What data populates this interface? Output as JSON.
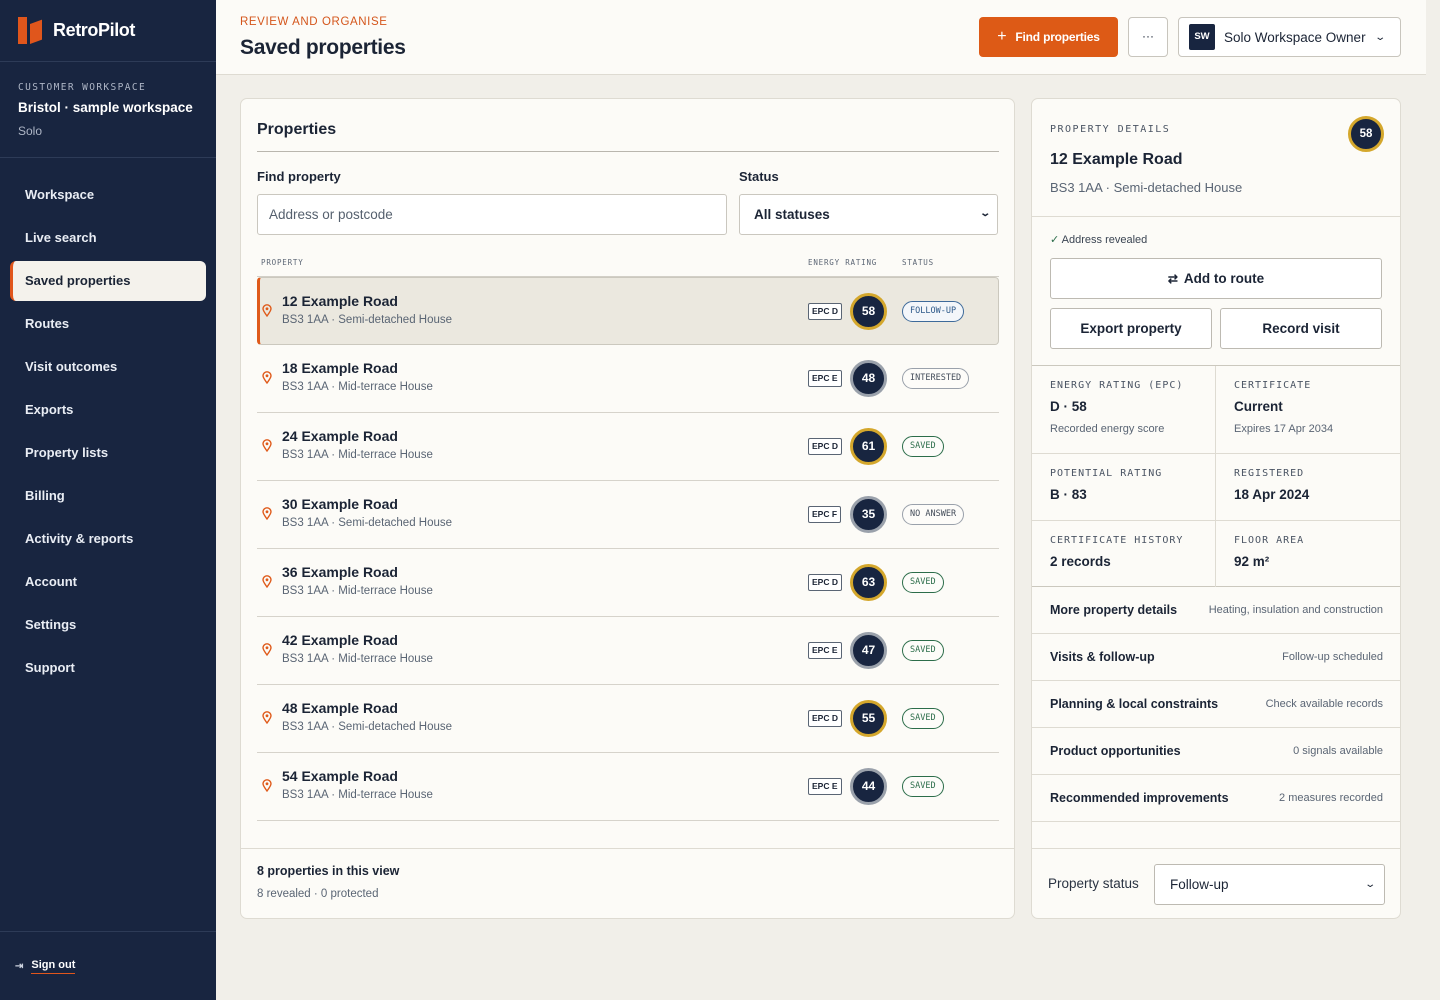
{
  "app": {
    "name": "RetroPilot"
  },
  "workspace": {
    "label": "CUSTOMER WORKSPACE",
    "name": "Bristol · sample workspace",
    "plan": "Solo"
  },
  "nav": [
    {
      "label": "Workspace",
      "active": false
    },
    {
      "label": "Live search",
      "active": false
    },
    {
      "label": "Saved properties",
      "active": true
    },
    {
      "label": "Routes",
      "active": false
    },
    {
      "label": "Visit outcomes",
      "active": false
    },
    {
      "label": "Exports",
      "active": false
    },
    {
      "label": "Property lists",
      "active": false
    },
    {
      "label": "Billing",
      "active": false
    },
    {
      "label": "Activity & reports",
      "active": false
    },
    {
      "label": "Account",
      "active": false
    },
    {
      "label": "Settings",
      "active": false
    },
    {
      "label": "Support",
      "active": false
    }
  ],
  "signout": {
    "label": "Sign out"
  },
  "header": {
    "eyebrow": "REVIEW AND ORGANISE",
    "title": "Saved properties",
    "find_button": "Find properties",
    "more_button": "···",
    "user": {
      "initials": "SW",
      "name": "Solo Workspace Owner"
    }
  },
  "properties": {
    "heading": "Properties",
    "find_label": "Find property",
    "find_placeholder": "Address or postcode",
    "status_label": "Status",
    "status_value": "All statuses",
    "columns": {
      "property": "PROPERTY",
      "energy": "ENERGY RATING",
      "status": "STATUS"
    },
    "rows": [
      {
        "title": "12 Example Road",
        "sub": "BS3 1AA · Semi-detached House",
        "epc": "EPC D",
        "score": "58",
        "status": "FOLLOW-UP"
      },
      {
        "title": "18 Example Road",
        "sub": "BS3 1AA · Mid-terrace House",
        "epc": "EPC E",
        "score": "48",
        "status": "INTERESTED"
      },
      {
        "title": "24 Example Road",
        "sub": "BS3 1AA · Mid-terrace House",
        "epc": "EPC D",
        "score": "61",
        "status": "SAVED"
      },
      {
        "title": "30 Example Road",
        "sub": "BS3 1AA · Semi-detached House",
        "epc": "EPC F",
        "score": "35",
        "status": "NO ANSWER"
      },
      {
        "title": "36 Example Road",
        "sub": "BS3 1AA · Mid-terrace House",
        "epc": "EPC D",
        "score": "63",
        "status": "SAVED"
      },
      {
        "title": "42 Example Road",
        "sub": "BS3 1AA · Mid-terrace House",
        "epc": "EPC E",
        "score": "47",
        "status": "SAVED"
      },
      {
        "title": "48 Example Road",
        "sub": "BS3 1AA · Semi-detached House",
        "epc": "EPC D",
        "score": "55",
        "status": "SAVED"
      },
      {
        "title": "54 Example Road",
        "sub": "BS3 1AA · Mid-terrace House",
        "epc": "EPC E",
        "score": "44",
        "status": "SAVED"
      }
    ],
    "footer_main": "8 properties in this view",
    "footer_sub": "8 revealed · 0 protected"
  },
  "details": {
    "eyebrow": "PROPERTY DETAILS",
    "score": "58",
    "title": "12 Example Road",
    "sub": "BS3 1AA · Semi-detached House",
    "revealed": "Address revealed",
    "add_route": "Add to route",
    "export": "Export property",
    "record": "Record visit",
    "cells": [
      {
        "label": "ENERGY RATING (EPC)",
        "value": "D · 58",
        "sub": "Recorded energy score"
      },
      {
        "label": "CERTIFICATE",
        "value": "Current",
        "sub": "Expires 17 Apr 2034"
      },
      {
        "label": "POTENTIAL RATING",
        "value": "B · 83",
        "sub": ""
      },
      {
        "label": "REGISTERED",
        "value": "18 Apr 2024",
        "sub": ""
      },
      {
        "label": "CERTIFICATE HISTORY",
        "value": "2 records",
        "sub": ""
      },
      {
        "label": "FLOOR AREA",
        "value": "92 m²",
        "sub": ""
      }
    ],
    "sections": [
      {
        "label": "More property details",
        "hint": "Heating, insulation and construction"
      },
      {
        "label": "Visits & follow-up",
        "hint": "Follow-up scheduled"
      },
      {
        "label": "Planning & local constraints",
        "hint": "Check available records"
      },
      {
        "label": "Product opportunities",
        "hint": "0 signals available"
      },
      {
        "label": "Recommended improvements",
        "hint": "2 measures recorded"
      }
    ],
    "status_label": "Property status",
    "status_value": "Follow-up"
  },
  "colors": {
    "accent": "#dd5a16",
    "sidebar": "#182540",
    "saved": "#2c6d4a",
    "ring": "#d4a72c"
  }
}
